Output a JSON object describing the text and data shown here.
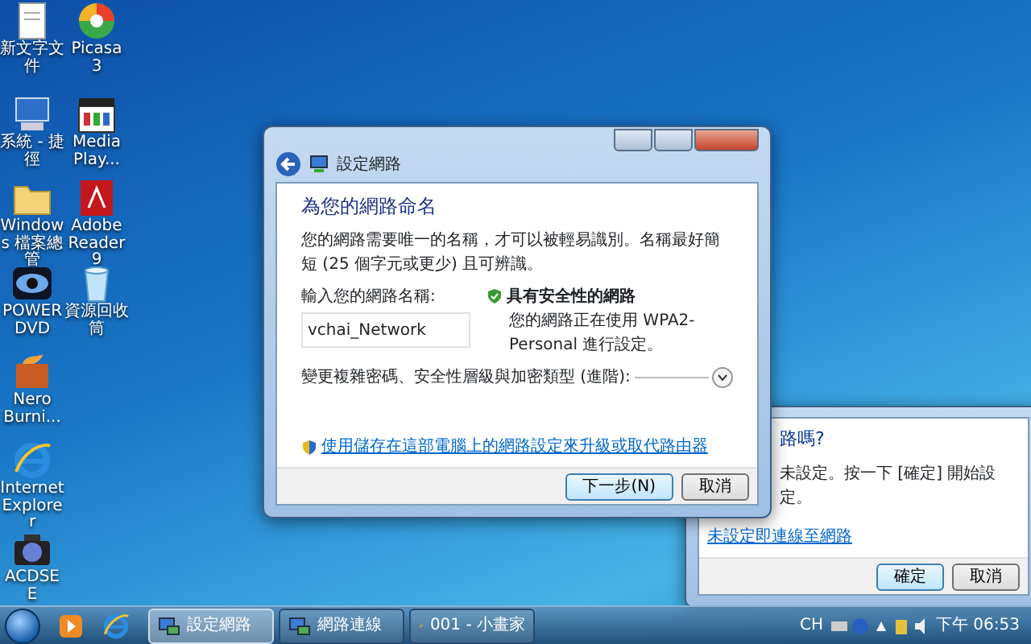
{
  "desktop_icons": [
    {
      "label": "新文字文件",
      "kind": "document"
    },
    {
      "label": "Picasa 3",
      "kind": "picasa"
    },
    {
      "label": "系統 - 捷徑",
      "kind": "computer"
    },
    {
      "label": "Media Play...",
      "kind": "media"
    },
    {
      "label": "Windows 檔案總管",
      "kind": "folder"
    },
    {
      "label": "Adobe Reader 9",
      "kind": "pdf"
    },
    {
      "label": "POWERDVD",
      "kind": "dvd"
    },
    {
      "label": "資源回收筒",
      "kind": "recycle"
    },
    {
      "label": "Nero Burni...",
      "kind": "nero"
    },
    {
      "label": "Internet Explorer",
      "kind": "ie"
    },
    {
      "label": "ACDSEE",
      "kind": "camera"
    }
  ],
  "wizard": {
    "title": "設定網路",
    "heading": "為您的網路命名",
    "description": "您的網路需要唯一的名稱，才可以被輕易識別。名稱最好簡短 (25 個字元或更少) 且可辨識。",
    "name_label": "輸入您的網路名稱:",
    "name_value": "vchai_Network",
    "security_title": "具有安全性的網路",
    "security_text": "您的網路正在使用 WPA2-Personal 進行設定。",
    "advanced_label": "變更複雜密碼、安全性層級與加密類型 (進階):",
    "expanded": false,
    "link": "使用儲存在這部電腦上的網路設定來升級或取代路由器",
    "buttons": [
      {
        "label": "下一步(N)",
        "default": true
      },
      {
        "label": "取消",
        "default": false
      }
    ]
  },
  "second_dialog": {
    "question": "路嗎?",
    "text": "未設定。按一下 [確定] 開始設定。",
    "link": "未設定即連線至網路",
    "buttons": [
      {
        "label": "確定",
        "default": true
      },
      {
        "label": "取消",
        "default": false
      }
    ]
  },
  "taskbar": {
    "tasks": [
      {
        "label": "設定網路",
        "selected": true,
        "kind": "network"
      },
      {
        "label": "網路連線",
        "selected": false,
        "kind": "network"
      },
      {
        "label": "001 - 小畫家",
        "selected": false,
        "kind": "paint"
      }
    ],
    "input_language": "CH",
    "clock": "下午 06:53"
  }
}
